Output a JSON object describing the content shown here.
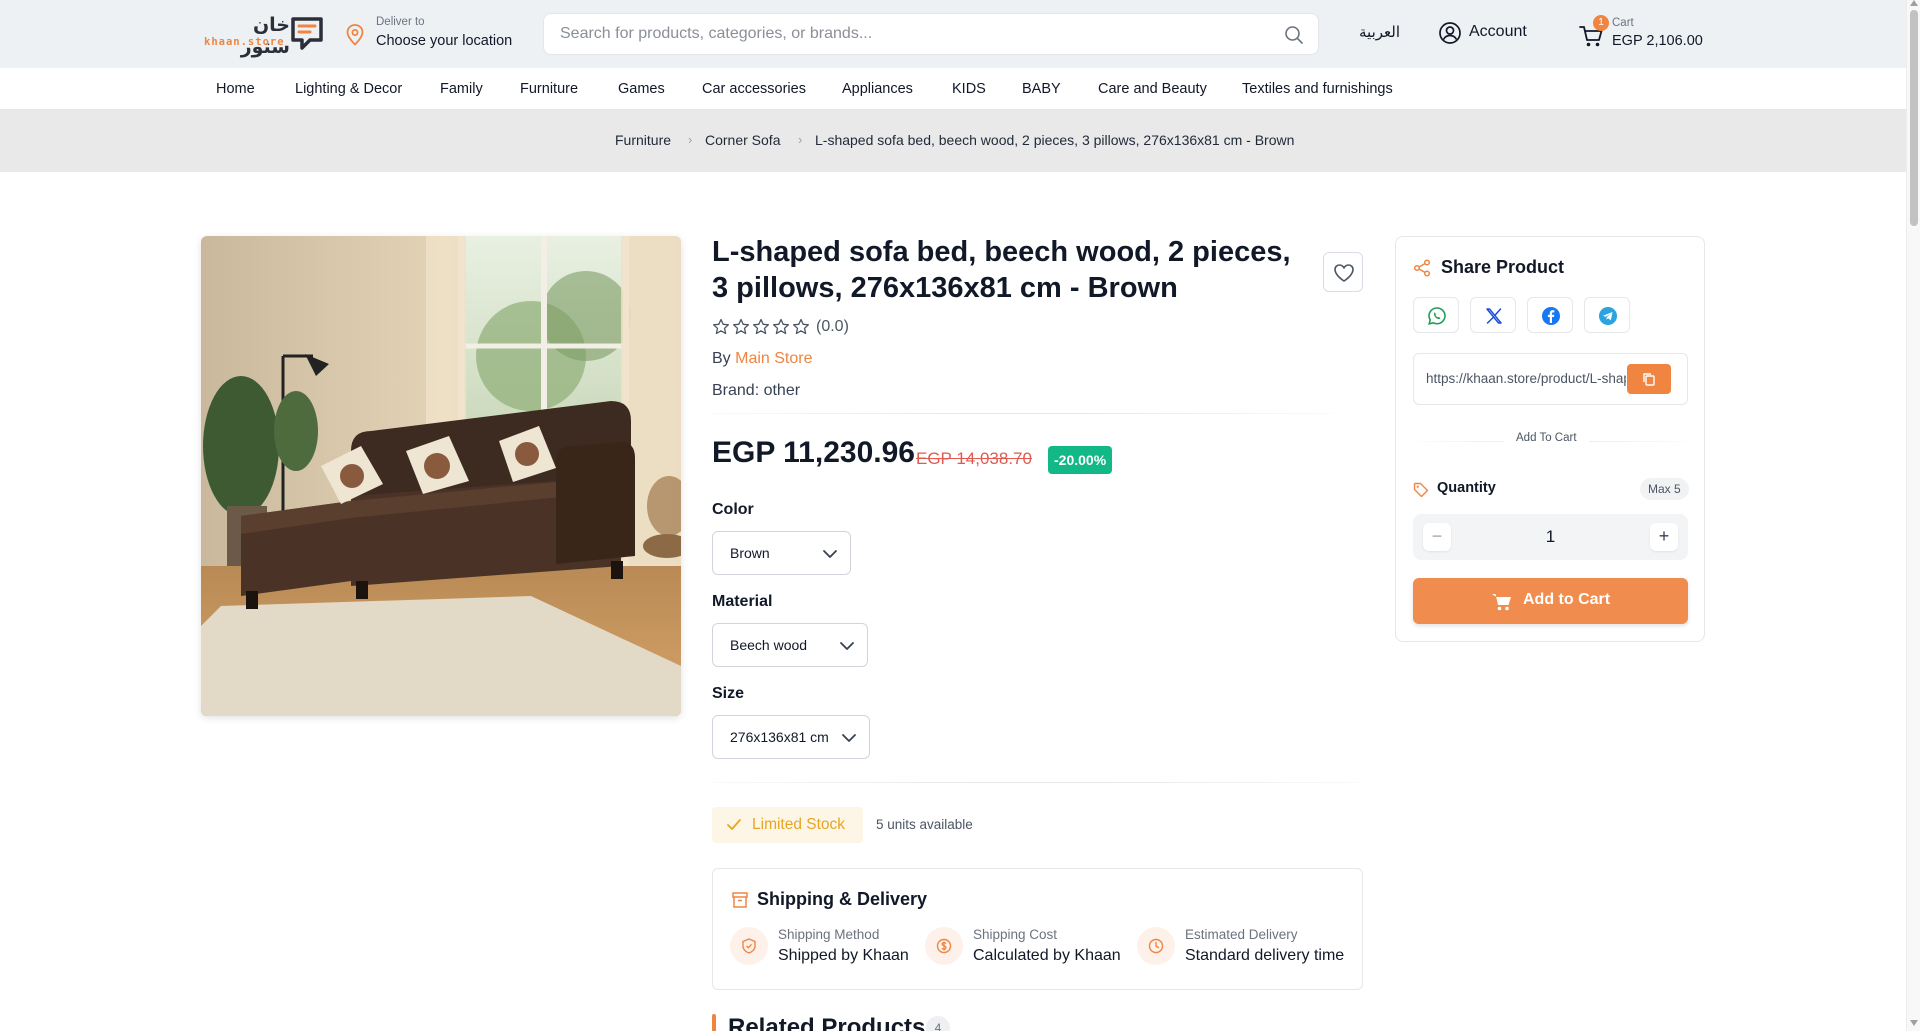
{
  "header": {
    "logo_arabic": "خان ستور",
    "logo_text": "khaan.store",
    "deliver_small": "Deliver to",
    "deliver_location": "Choose your location",
    "search_placeholder": "Search for products, categories, or brands...",
    "language": "العربية",
    "account_label": "Account",
    "cart_badge": "1",
    "cart_label": "Cart",
    "cart_total": "EGP 2,106.00",
    "accent_color": "#ef8541"
  },
  "nav": {
    "items": [
      "Home",
      "Lighting & Decor",
      "Family",
      "Furniture",
      "Games",
      "Car accessories",
      "Appliances",
      "KIDS",
      "BABY",
      "Care and Beauty",
      "Textiles and furnishings"
    ]
  },
  "breadcrumb": {
    "items": [
      "Furniture",
      "Corner Sofa",
      "L-shaped sofa bed, beech wood, 2 pieces, 3 pillows, 276x136x81 cm - Brown"
    ]
  },
  "product": {
    "title": "L-shaped sofa bed, beech wood, 2 pieces, 3 pillows, 276x136x81 cm - Brown",
    "rating_value": "(0.0)",
    "stars": 0,
    "by_prefix": "By",
    "store": "Main Store",
    "brand": "Brand: other",
    "price": "EGP 11,230.96",
    "old_price": "EGP 14,038.70",
    "discount": "-20.00%",
    "options": {
      "color_label": "Color",
      "color_value": "Brown",
      "material_label": "Material",
      "material_value": "Beech wood",
      "size_label": "Size",
      "size_value": "276x136x81 cm"
    },
    "stock_status": "Limited Stock",
    "stock_available": "5 units available"
  },
  "shipping": {
    "title": "Shipping & Delivery",
    "method_label": "Shipping Method",
    "method_value": "Shipped by Khaan",
    "cost_label": "Shipping Cost",
    "cost_value": "Calculated by Khaan",
    "delivery_label": "Estimated Delivery",
    "delivery_value": "Standard delivery time"
  },
  "related": {
    "title": "Related Products",
    "count": "4"
  },
  "sidebar": {
    "share_title": "Share Product",
    "share_icons": [
      "whatsapp-icon",
      "x-icon",
      "facebook-icon",
      "telegram-icon"
    ],
    "share_url": "https://khaan.store/product/L-shaped-sofa-bed",
    "add_to_cart_divider": "Add To Cart",
    "quantity_label": "Quantity",
    "quantity_max": "Max 5",
    "quantity_value": "1",
    "minus": "−",
    "plus": "+",
    "add_to_cart_button": "Add to Cart"
  }
}
